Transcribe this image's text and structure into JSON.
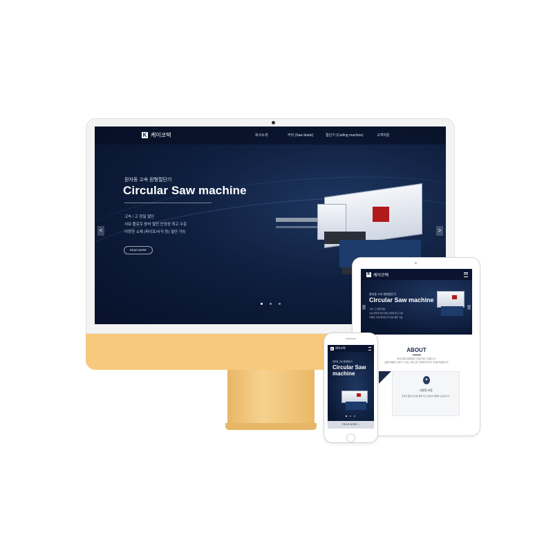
{
  "brand": {
    "name": "케이코텍"
  },
  "desktop": {
    "nav": [
      "회사소개",
      "커터 (Saw blade)",
      "절단기 (Cutting machine)",
      "고객지원"
    ],
    "hero": {
      "subtitle": "원자동 고속 원형절단기",
      "title": "Circular Saw machine",
      "bullets": [
        "고속 / 고 정밀 절단",
        "서보 플로우 방식 절단 안정성 최고 수준",
        "다양한 소재 (파이프/사각 등) 절단 가능"
      ],
      "read_more": "READ MORE",
      "prev_arrow": "<",
      "next_arrow": ">"
    }
  },
  "tablet": {
    "hero": {
      "subtitle": "원자동 고속 원형절단기",
      "title": "Circular Saw machine",
      "bullets": [
        "고속 / 고 정밀 절단",
        "서보 플로우 방식 절단 안정성 최고 수준",
        "다양한 소재 (파이프/사각 등) 절단 가능"
      ]
    },
    "about": {
      "heading": "ABOUT",
      "text_1": "케이코텍은 원형절단기 전문 제조 기업입니다.",
      "text_2": "고품질 제품과 신뢰할 수 있는 서비스로 고객에게 최고의 가치를 제공합니다.",
      "card_title": "고품질 보증",
      "card_text": "엄격한 품질 관리를 통해 최고 품질의 제품을 보증합니다."
    }
  },
  "phone": {
    "hero": {
      "subtitle": "원자동 고속 원형절단기",
      "title": "Circular Saw machine",
      "read_more": "READ MORE >"
    }
  },
  "colors": {
    "hero_bg": "#0f1f3f",
    "imac_chin": "#f7c97c",
    "accent_red": "#b11a1a",
    "navy": "#1c2a4a"
  }
}
